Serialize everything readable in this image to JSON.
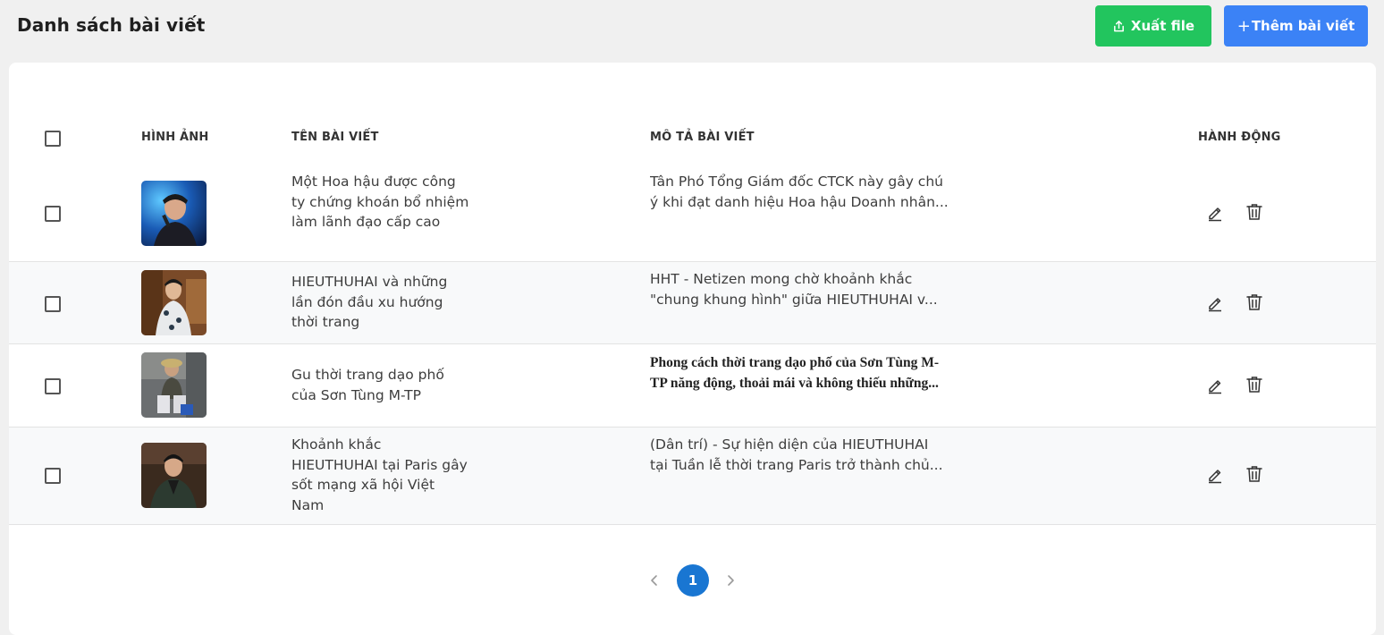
{
  "page": {
    "title": "Danh sách bài viết"
  },
  "toolbar": {
    "export_label": "Xuất file",
    "add_label": "Thêm bài viết",
    "add_prefix": "+"
  },
  "table": {
    "headers": {
      "image": "HÌNH ẢNH",
      "title": "TÊN BÀI VIẾT",
      "description": "MÔ TẢ BÀI VIẾT",
      "actions": "HÀNH ĐỘNG"
    },
    "rows": [
      {
        "title": "Một Hoa hậu được công ty chứng khoán bổ nhiệm làm lãnh đạo cấp cao",
        "desc_line1": "Tân Phó Tổng Giám đốc CTCK này gây chú",
        "desc_line2": "ý khi đạt danh hiệu Hoa hậu Doanh nhân..."
      },
      {
        "title": "HIEUTHUHAI và những lần đón đầu xu hướng thời trang",
        "desc_line1": "HHT - Netizen mong chờ khoảnh khắc",
        "desc_line2": "\"chung khung hình\" giữa HIEUTHUHAI v..."
      },
      {
        "title": "Gu thời trang dạo phố của Sơn Tùng M-TP",
        "desc_line1": "Phong cách thời trang dạo phố của Sơn Tùng M-",
        "desc_line2": "TP năng động, thoải mái và không thiếu những..."
      },
      {
        "title": "Khoảnh khắc HIEUTHUHAI tại Paris gây sốt mạng xã hội Việt Nam",
        "desc_line1": "(Dân trí) - Sự hiện diện của HIEUTHUHAI",
        "desc_line2": "tại Tuần lễ thời trang Paris trở thành chủ..."
      }
    ]
  },
  "pagination": {
    "current_page": "1"
  },
  "icons": {
    "export": "upload-icon",
    "edit": "pencil-icon",
    "delete": "trash-icon",
    "prev": "chevron-left-icon",
    "next": "chevron-right-icon"
  },
  "colors": {
    "export_button": "#22c55e",
    "add_button": "#3b82f6",
    "page_active": "#1976d2"
  }
}
